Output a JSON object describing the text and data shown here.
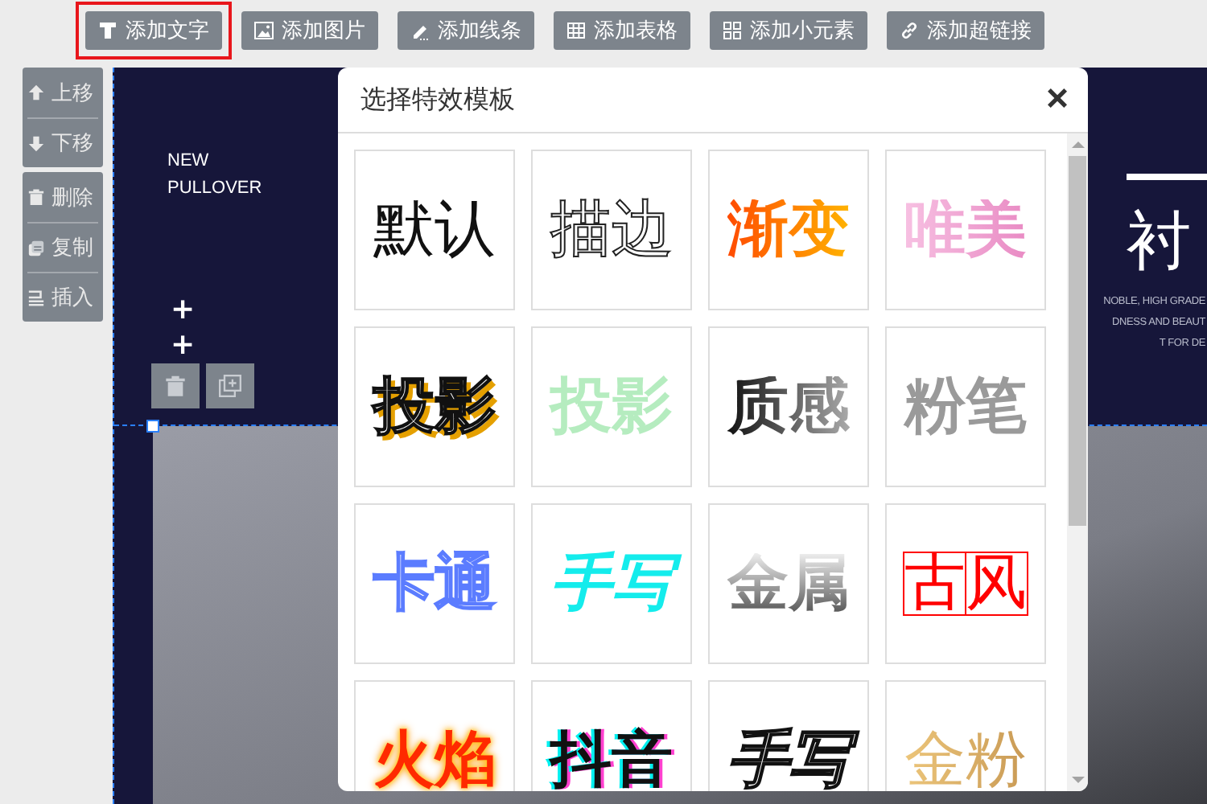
{
  "toolbar": [
    {
      "label": "添加文字",
      "kind": "text",
      "highlighted": true
    },
    {
      "label": "添加图片",
      "kind": "image",
      "highlighted": false
    },
    {
      "label": "添加线条",
      "kind": "line",
      "highlighted": false
    },
    {
      "label": "添加表格",
      "kind": "table",
      "highlighted": false
    },
    {
      "label": "添加小元素",
      "kind": "element",
      "highlighted": false
    },
    {
      "label": "添加超链接",
      "kind": "link",
      "highlighted": false
    }
  ],
  "sidebar": [
    {
      "items": [
        {
          "label": "上移",
          "kind": "up"
        },
        {
          "label": "下移",
          "kind": "down"
        }
      ]
    },
    {
      "items": [
        {
          "label": "删除",
          "kind": "delete"
        },
        {
          "label": "复制",
          "kind": "copy"
        },
        {
          "label": "插入",
          "kind": "insert"
        }
      ]
    }
  ],
  "canvas": {
    "headline": [
      "NEW",
      "PULLOVER"
    ],
    "plus_signs": [
      "+",
      "+"
    ],
    "title_fragment": "衬",
    "subtitle_lines": [
      "NOBLE, HIGH GRADE",
      "DNESS AND BEAUT",
      "T FOR DE"
    ]
  },
  "modal": {
    "title": "选择特效模板",
    "close": "×",
    "templates": [
      {
        "label": "默认",
        "kind": "plain"
      },
      {
        "label": "描边",
        "kind": "outline"
      },
      {
        "label": "渐变",
        "kind": "gradient"
      },
      {
        "label": "唯美",
        "kind": "pastel"
      },
      {
        "label": "投影",
        "kind": "shadow"
      },
      {
        "label": "投影",
        "kind": "pattern"
      },
      {
        "label": "质感",
        "kind": "texture"
      },
      {
        "label": "粉笔",
        "kind": "chalk"
      },
      {
        "label": "卡通",
        "kind": "cartoon"
      },
      {
        "label": "手写",
        "kind": "neon"
      },
      {
        "label": "金属",
        "kind": "metal"
      },
      {
        "label": "古风",
        "kind": "grid"
      },
      {
        "label": "火焰",
        "kind": "flame"
      },
      {
        "label": "抖音",
        "kind": "glitch"
      },
      {
        "label": "手写",
        "kind": "brush"
      },
      {
        "label": "金粉",
        "kind": "gold"
      }
    ]
  }
}
